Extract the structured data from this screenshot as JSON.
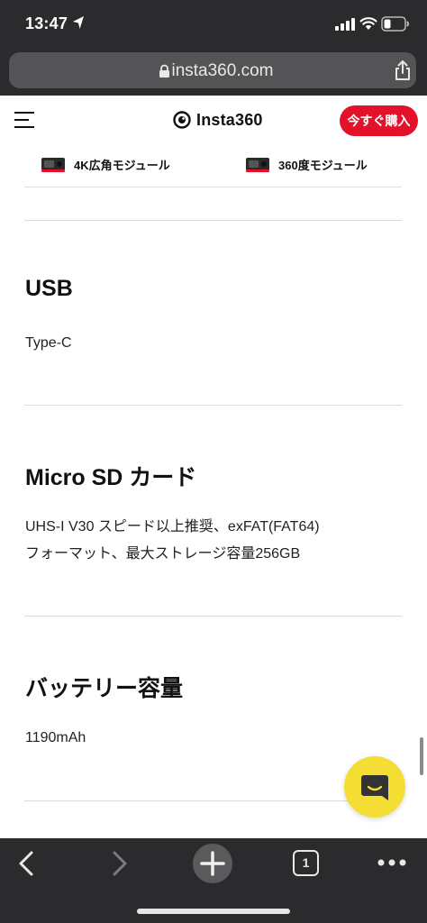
{
  "status_bar": {
    "time": "13:47"
  },
  "browser": {
    "url": "insta360.com",
    "tab_count": "1"
  },
  "site": {
    "logo_text": "Insta360",
    "buy_label": "今すぐ購入"
  },
  "modules": [
    "4K広角モジュール",
    "360度モジュール"
  ],
  "specs": [
    {
      "title": "USB",
      "lines": [
        "Type-C"
      ]
    },
    {
      "title": "Micro SD カード",
      "lines": [
        "UHS-I V30 スピード以上推奨、exFAT(FAT64)",
        "フォーマット、最大ストレージ容量256GB"
      ]
    },
    {
      "title": "バッテリー容量",
      "lines": [
        "1190mAh"
      ]
    }
  ],
  "icons": {
    "status": [
      "location-arrow-icon",
      "cellular-signal-icon",
      "wifi-icon",
      "battery-icon"
    ],
    "browser": [
      "lock-icon",
      "share-icon"
    ],
    "site": [
      "hamburger-menu-icon",
      "insta360-logo-icon",
      "camera-module-icon",
      "chat-icon"
    ],
    "toolbar": [
      "back-arrow-icon",
      "forward-arrow-icon",
      "plus-icon",
      "tabs-icon",
      "more-icon"
    ]
  },
  "colors": {
    "brand_red": "#e4112a",
    "chat_yellow": "#f5de33",
    "chrome_dark": "#2b2b2d",
    "url_pill": "#545457"
  }
}
